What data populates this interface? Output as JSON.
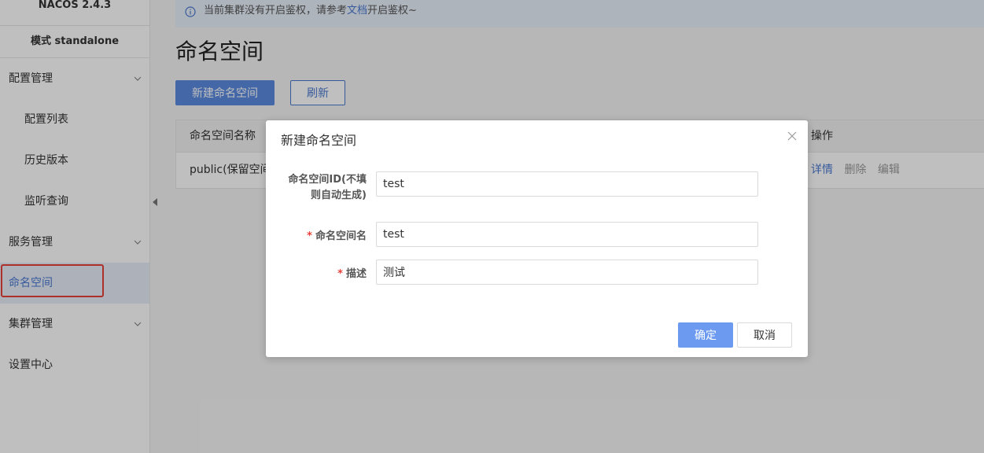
{
  "sidebar": {
    "brand": "NACOS 2.4.3",
    "mode": "模式 standalone",
    "groups": [
      {
        "label": "配置管理"
      },
      {
        "label": "服务管理"
      },
      {
        "label": "集群管理"
      }
    ],
    "config_items": [
      "配置列表",
      "历史版本",
      "监听查询"
    ],
    "namespace": "命名空间",
    "settings": "设置中心"
  },
  "alert": {
    "prefix": "当前集群没有开启鉴权，请参考",
    "link": "文档",
    "suffix": "开启鉴权~"
  },
  "page": {
    "title": "命名空间",
    "new_button": "新建命名空间",
    "refresh_button": "刷新"
  },
  "table": {
    "col_name": "命名空间名称",
    "col_ops": "操作",
    "rows": [
      {
        "name": "public(保留空间",
        "ops": [
          "详情",
          "删除",
          "编辑"
        ]
      }
    ]
  },
  "dialog": {
    "title": "新建命名空间",
    "id_label_line1": "命名空间ID(不填",
    "id_label_line2": "则自动生成)",
    "id_value": "test",
    "name_label": "命名空间名",
    "name_value": "test",
    "desc_label": "描述",
    "desc_value": "测试",
    "ok": "确定",
    "cancel": "取消",
    "required_mark": "*"
  },
  "colors": {
    "primary": "#5b8ae0",
    "link": "#4a78d0",
    "highlight": "#e8413a"
  }
}
